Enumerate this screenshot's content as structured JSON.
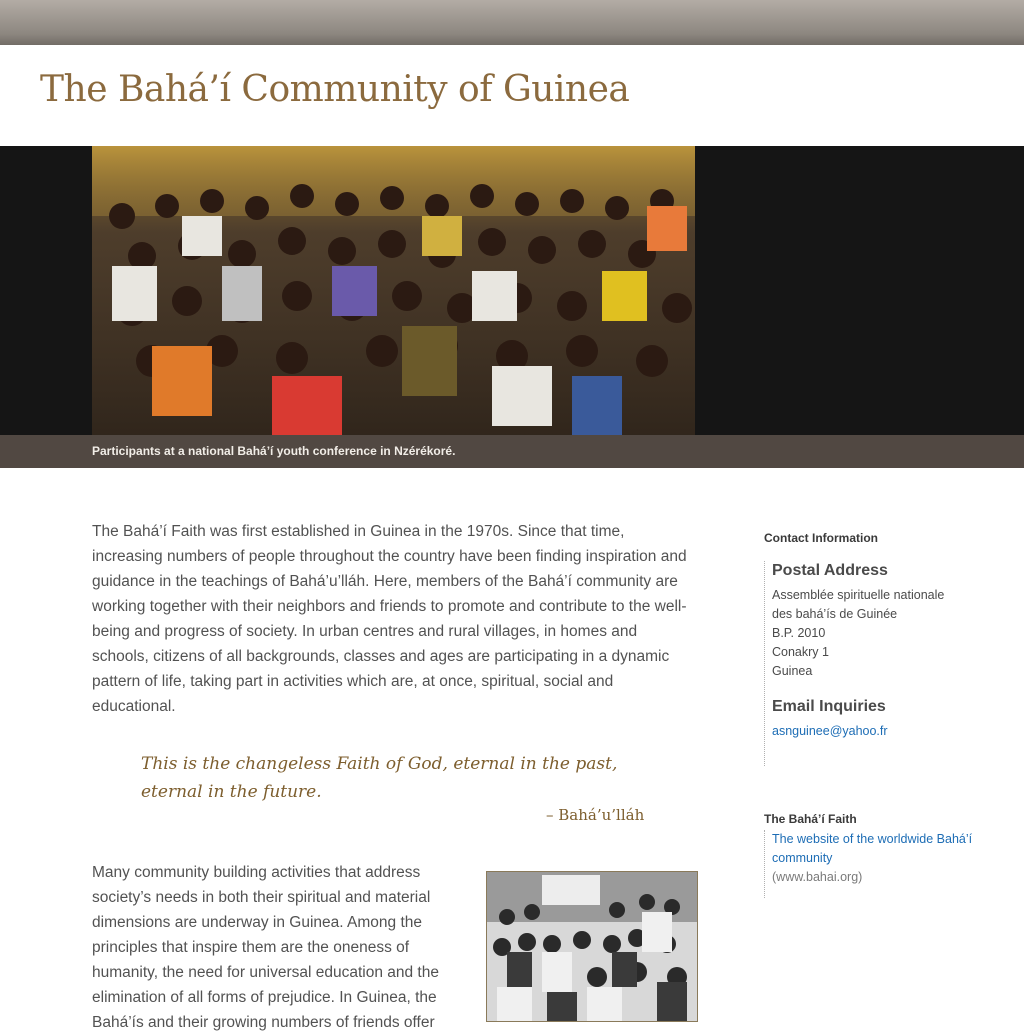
{
  "header": {
    "title": "The Bahá’í Community of Guinea"
  },
  "hero": {
    "caption": "Participants at a national Bahá’í youth conference in Nzérékoré."
  },
  "main": {
    "intro": "The Bahá’í Faith was first established in Guinea in the 1970s. Since that time, increasing numbers of people throughout the country have been finding inspiration and guidance in the teachings of Bahá’u’lláh. Here, members of the Bahá’í community are working together with their neighbors and friends to promote and contribute to the well-being and progress of society. In urban centres and rural villages, in homes and schools, citizens of all backgrounds, classes and ages are participating in a dynamic pattern of life, taking part in activities which are, at once, spiritual, social and educational.",
    "quote": "This is the changeless Faith of God, eternal in the past, eternal in the future.",
    "quote_attribution": "– Bahá’u’lláh",
    "para2": "Many community building activities that address society’s needs in both their spiritual and material dimensions are underway in Guinea. Among the principles that inspire them are the oneness of humanity, the need for universal education and the elimination of all forms of prejudice. In Guinea, the Bahá’ís and their growing numbers of friends offer"
  },
  "sidebar": {
    "contact_heading": "Contact Information",
    "postal_heading": "Postal Address",
    "postal_lines": [
      "Assemblée spirituelle nationale",
      "des bahá’ís de Guinée",
      "B.P. 2010",
      "Conakry 1",
      "Guinea"
    ],
    "email_heading": "Email Inquiries",
    "email": "asnguinee@yahoo.fr",
    "faith_heading": "The Bahá’í Faith",
    "faith_link": "The website of the worldwide Bahá’í community",
    "faith_url_text": "(www.bahai.org)"
  },
  "colors": {
    "title": "#8b6a3e",
    "quote": "#7d5e2e",
    "link": "#1d6db5",
    "caption_bar": "#514842",
    "hero_bg": "#151515"
  }
}
